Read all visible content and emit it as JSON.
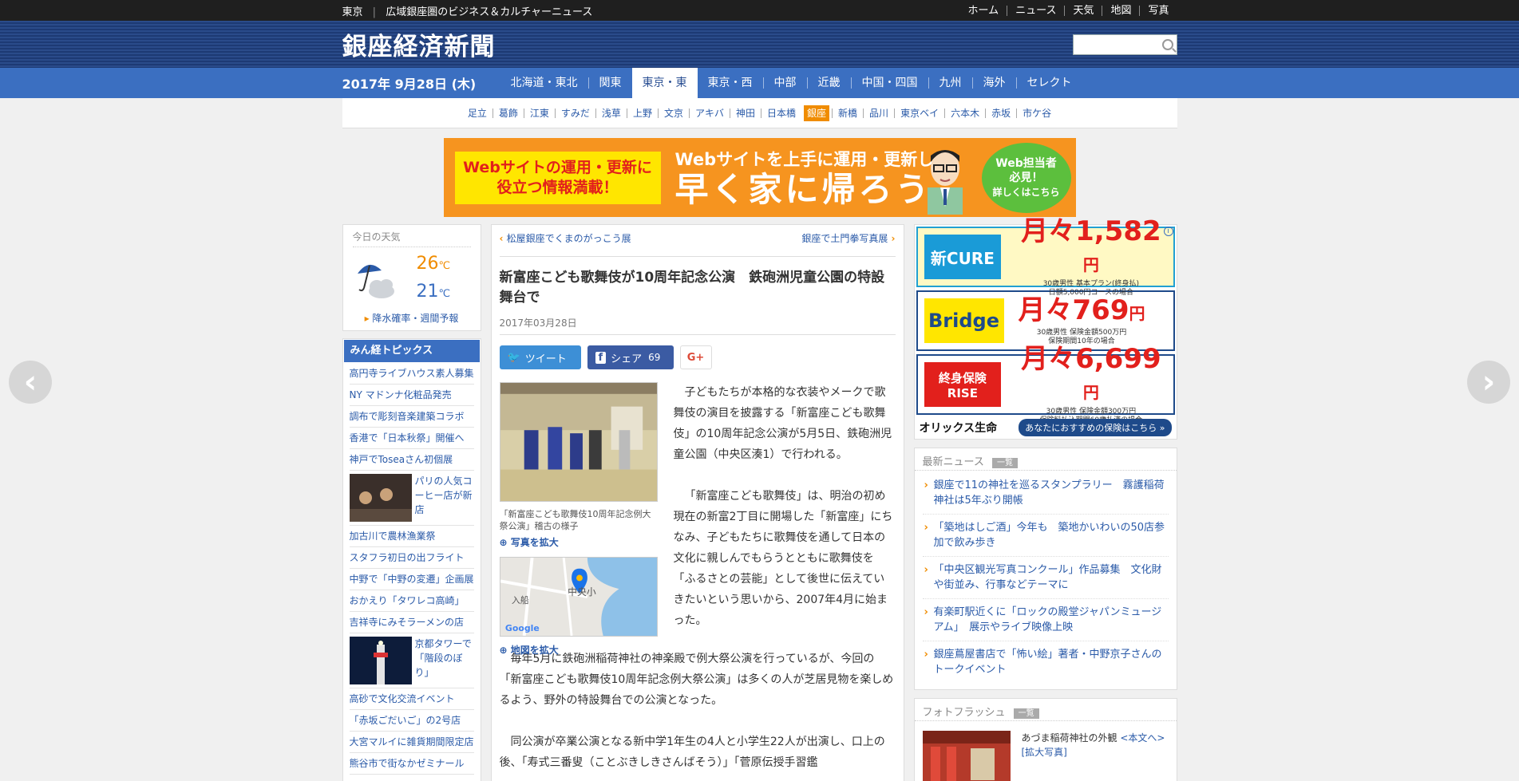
{
  "topbar": {
    "area": "東京",
    "tagline": "広域銀座圏のビジネス＆カルチャーニュース",
    "links": [
      "ホーム",
      "ニュース",
      "天気",
      "地図",
      "写真"
    ]
  },
  "header": {
    "logo": "銀座経済新聞",
    "search_placeholder": ""
  },
  "nav": {
    "date": "2017年 9月28日 (木)",
    "regions": [
      "北海道・東北",
      "関東",
      "東京・東",
      "東京・西",
      "中部",
      "近畿",
      "中国・四国",
      "九州",
      "海外",
      "セレクト"
    ],
    "active_region": "東京・東",
    "areas": [
      "足立",
      "葛飾",
      "江東",
      "すみだ",
      "浅草",
      "上野",
      "文京",
      "アキバ",
      "神田",
      "日本橋",
      "銀座",
      "新橋",
      "品川",
      "東京ベイ",
      "六本木",
      "赤坂",
      "市ケ谷"
    ],
    "active_area": "銀座"
  },
  "banner": {
    "left_line1": "Webサイトの運用・更新に",
    "left_line2": "役立つ情報満載！",
    "mid_line1": "Webサイトを上手に運用・更新して",
    "mid_line2": "早く家に帰ろう",
    "bubble_line1": "Web担当者",
    "bubble_line2": "必見！",
    "bubble_line3": "詳しくはこちら"
  },
  "weather": {
    "heading": "今日の天気",
    "high": "26",
    "low": "21",
    "unit": "℃",
    "link": "降水確率・週間予報",
    "icon": "umbrella-cloud-icon"
  },
  "topics": {
    "heading": "みん経トピックス",
    "items": [
      {
        "text": "高円寺ライブハウス素人募集"
      },
      {
        "text": "NY マドンナ化粧品発売"
      },
      {
        "text": "調布で彫刻音楽建築コラボ"
      },
      {
        "text": "香港で「日本秋祭」開催へ"
      },
      {
        "text": "神戸でToseaさん初個展"
      },
      {
        "text": "パリの人気コーヒー店が新店",
        "image": true
      },
      {
        "text": "加古川で農林漁業祭"
      },
      {
        "text": "スタフラ初日の出フライト"
      },
      {
        "text": "中野で「中野の変遷」企画展"
      },
      {
        "text": "おかえり「タワレコ高崎」"
      },
      {
        "text": "吉祥寺にみそラーメンの店"
      },
      {
        "text": "京都タワーで「階段のぼり」",
        "image": true
      },
      {
        "text": "高砂で文化交流イベント"
      },
      {
        "text": "「赤坂ごだいご」の2号店"
      },
      {
        "text": "大宮マルイに雑貨期間限定店"
      },
      {
        "text": "熊谷市で街なかゼミナール"
      }
    ]
  },
  "article": {
    "prev": "松屋銀座でくまのがっこう展",
    "next": "銀座で土門拳写真展",
    "title": "新富座こども歌舞伎が10周年記念公演　鉄砲洲児童公園の特設舞台で",
    "date": "2017年03月28日",
    "tweet_label": "ツイート",
    "share_label": "シェア",
    "share_count": "69",
    "gplus_label": "G+",
    "caption": "「新富座こども歌舞伎10周年記念例大祭公演」稽古の様子",
    "photo_enlarge": "写真を拡大",
    "map_enlarge": "地図を拡大",
    "map_labels": {
      "google": "Google",
      "place": "中央小",
      "entrance": "入船"
    },
    "paragraphs": [
      "子どもたちが本格的な衣装やメークで歌舞伎の演目を披露する「新富座こども歌舞伎」の10周年記念公演が5月5日、鉄砲洲児童公園（中央区湊1）で行われる。",
      "「新富座こども歌舞伎」は、明治の初め現在の新富2丁目に開場した「新富座」にちなみ、子どもたちに歌舞伎を通して日本の文化に親しんでもらうとともに歌舞伎を「ふるさとの芸能」として後世に伝えていきたいという思いから、2007年4月に始まった。",
      "毎年5月に鉄砲洲稲荷神社の神楽殿で例大祭公演を行っているが、今回の「新富座こども歌舞伎10周年記念例大祭公演」は多くの人が芝居見物を楽しめるよう、野外の特設舞台での公演となった。",
      "同公演が卒業公演となる新中学1年生の4人と小学生22人が出演し、口上の後、「寿式三番叟（ことぶきしきさんばそう）」「菅原伝授手習鑑"
    ]
  },
  "ads": {
    "ad1": {
      "brand": "新CURE",
      "price": "月々1,582",
      "unit": "円",
      "note1": "30歳男性 基本プラン(終身払)",
      "note2": "日額5,000円コースの場合"
    },
    "ad2": {
      "brand": "Bridge",
      "price": "月々769",
      "unit": "円",
      "note1": "30歳男性 保険金額500万円",
      "note2": "保険期間10年の場合"
    },
    "ad3": {
      "brand": "終身保険RISE",
      "price": "月々6,699",
      "unit": "円",
      "note1": "30歳男性 保険金額300万円",
      "note2": "保険料払込期間60歳払済の場合"
    },
    "company": "オリックス生命",
    "cta": "あなたにおすすめの保険はこちら »",
    "info": "i"
  },
  "latest_news": {
    "heading": "最新ニュース",
    "more": "一覧",
    "items": [
      "銀座で11の神社を巡るスタンプラリー　霧護稲荷神社は5年ぶり開帳",
      "「築地はしご酒」今年も　築地かいわいの50店参加で飲み歩き",
      "「中央区観光写真コンクール」作品募集　文化財や街並み、行事などテーマに",
      "有楽町駅近くに「ロックの殿堂ジャパンミュージアム」　展示やライブ映像上映",
      "銀座蔦屋書店で「怖い絵」著者・中野京子さんのトークイベント"
    ]
  },
  "photo_flash": {
    "heading": "フォトフラッシュ",
    "more": "一覧",
    "caption": "あづま稲荷神社の外観",
    "link1": "<本文へ>",
    "link2": "[拡大写真]"
  },
  "colors": {
    "accent": "#3b6fc1",
    "header": "#1d3a74",
    "highlight": "#f08c00"
  }
}
